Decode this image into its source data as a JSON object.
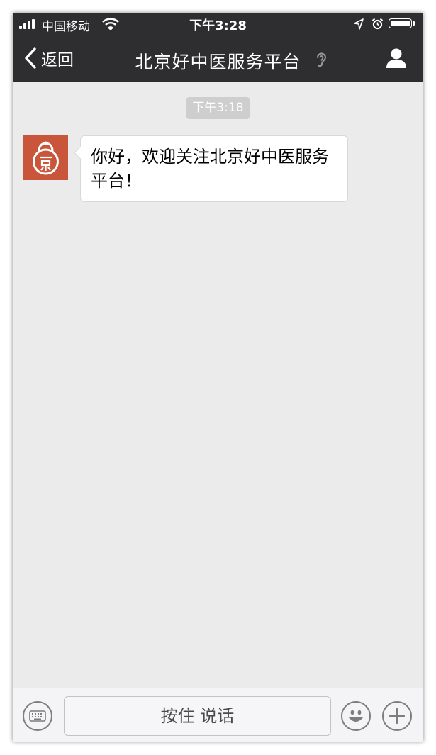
{
  "status_bar": {
    "carrier": "中国移动",
    "time": "下午3:28"
  },
  "nav": {
    "back_label": "返回",
    "title": "北京好中医服务平台",
    "icons": {
      "back": "chevron-left-icon",
      "mode": "ear-icon",
      "profile": "profile-icon"
    }
  },
  "chat": {
    "timestamp": "下午3:18",
    "messages": [
      {
        "sender": "official-account",
        "text": "你好，欢迎关注北京好中医服务平台！"
      }
    ]
  },
  "input_bar": {
    "hold_to_talk": "按住 说话",
    "icons": [
      "keyboard-icon",
      "emoji-icon",
      "plus-icon"
    ]
  },
  "colors": {
    "navbar": "#2e2e30",
    "chat_background": "#ebebeb",
    "avatar": "#c9553a",
    "timestamp_pill": "#cecece"
  }
}
